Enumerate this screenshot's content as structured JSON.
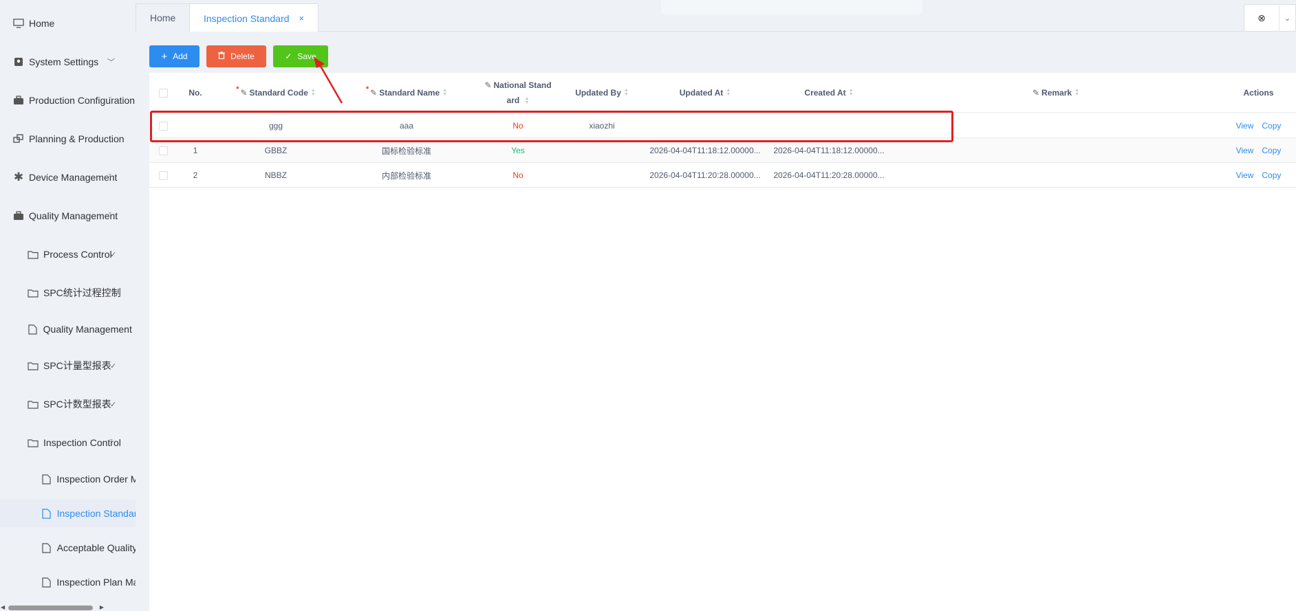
{
  "sidebar": {
    "items": [
      {
        "label": "Home",
        "icon": "monitor-icon"
      },
      {
        "label": "System Settings",
        "icon": "contact-icon"
      },
      {
        "label": "Production Configuration",
        "icon": "briefcase-icon"
      },
      {
        "label": "Planning & Production",
        "icon": "windows-icon"
      },
      {
        "label": "Device Management",
        "icon": "asterisk-icon"
      },
      {
        "label": "Quality Management",
        "icon": "briefcase-icon"
      },
      {
        "label": "Process Control",
        "icon": "folder-icon"
      },
      {
        "label": "SPC统计过程控制",
        "icon": "folder-icon"
      },
      {
        "label": "Quality Management I",
        "icon": "file-icon"
      },
      {
        "label": "SPC计量型报表",
        "icon": "folder-icon"
      },
      {
        "label": "SPC计数型报表",
        "icon": "folder-icon"
      },
      {
        "label": "Inspection Control",
        "icon": "folder-icon"
      },
      {
        "label": "Inspection Order M",
        "icon": "file-icon"
      },
      {
        "label": "Inspection Standar",
        "icon": "file-icon"
      },
      {
        "label": "Acceptable Quality",
        "icon": "file-icon"
      },
      {
        "label": "Inspection Plan Ma",
        "icon": "file-icon"
      }
    ]
  },
  "tabs": [
    {
      "label": "Home"
    },
    {
      "label": "Inspection Standard",
      "close": "×"
    }
  ],
  "tab_tools": {
    "close_all": "⊗",
    "dropdown": "⌄"
  },
  "toolbar": {
    "add_label": "Add",
    "add_icon": "+",
    "delete_label": "Delete",
    "delete_icon": "🗑",
    "save_label": "Save",
    "save_icon": "✓"
  },
  "table": {
    "columns": {
      "no": "No.",
      "standard_code": "Standard Code",
      "standard_name": "Standard Name",
      "national_standard": "National Stand ard",
      "updated_by": "Updated By",
      "updated_at": "Updated At",
      "created_at": "Created At",
      "remark": "Remark",
      "actions": "Actions"
    },
    "rows": [
      {
        "no": "",
        "code": "ggg",
        "name": "aaa",
        "national": "No",
        "updated_by": "xiaozhi",
        "updated_at": "",
        "created_at": "",
        "remark": "",
        "view": "View",
        "copy": "Copy"
      },
      {
        "no": "1",
        "code": "GBBZ",
        "name": "国标检验标准",
        "national": "Yes",
        "updated_by": "",
        "updated_at": "2026-04-04T11:18:12.00000...",
        "created_at": "2026-04-04T11:18:12.00000...",
        "remark": "",
        "view": "View",
        "copy": "Copy"
      },
      {
        "no": "2",
        "code": "NBBZ",
        "name": "内部检验标准",
        "national": "No",
        "updated_by": "",
        "updated_at": "2026-04-04T11:20:28.00000...",
        "created_at": "2026-04-04T11:20:28.00000...",
        "remark": "",
        "view": "View",
        "copy": "Copy"
      }
    ]
  },
  "colors": {
    "primary": "#2d8cf0",
    "danger": "#ed4014",
    "success": "#52c41a",
    "annotation": "#e02020"
  }
}
